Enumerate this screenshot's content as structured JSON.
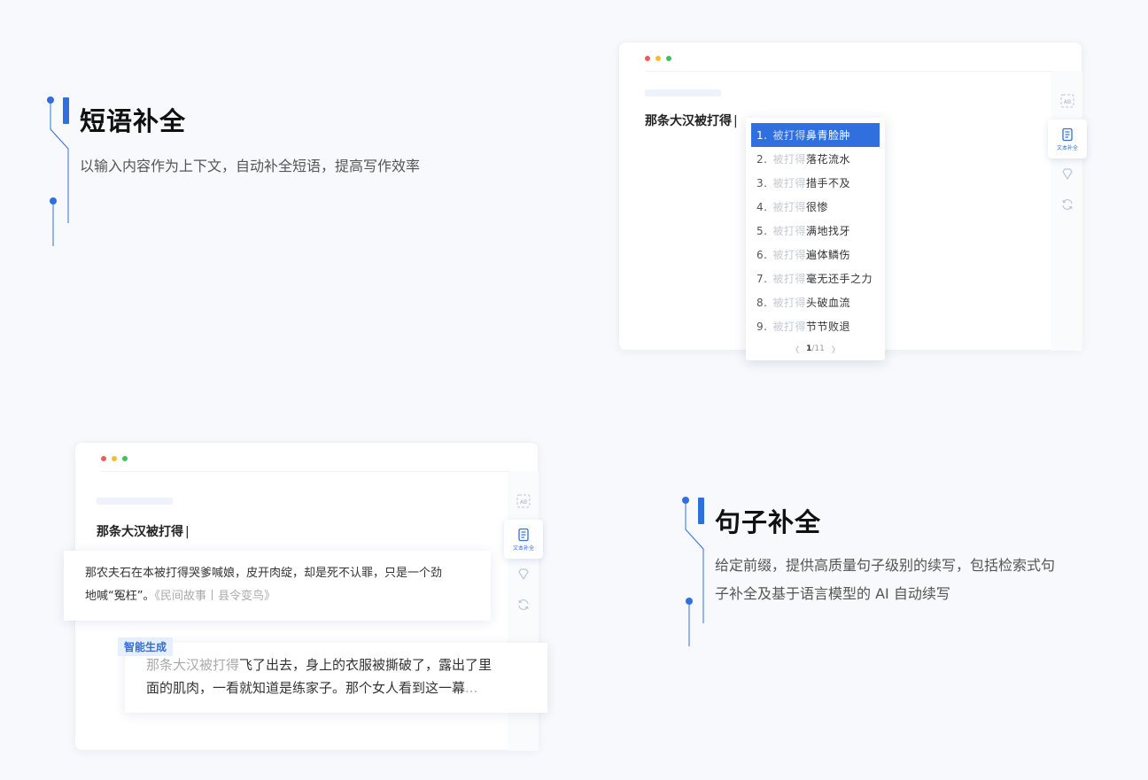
{
  "phrase_feature": {
    "title": "短语补全",
    "description": "以输入内容作为上下文，自动补全短语，提高写作效率"
  },
  "sentence_feature": {
    "title": "句子补全",
    "description_line1": "给定前缀，提供高质量句子级别的续写，包括检索式句",
    "description_line2": "子补全及基于语言模型的 AI 自动续写"
  },
  "window_top": {
    "prompt": "那条大汉被打得",
    "caret": "|",
    "rail_active_label": "文本补全",
    "suggestions": [
      {
        "num": "1.",
        "prefix": "被打得",
        "completion": "鼻青脸肿",
        "selected": true
      },
      {
        "num": "2.",
        "prefix": "被打得",
        "completion": "落花流水",
        "selected": false
      },
      {
        "num": "3.",
        "prefix": "被打得",
        "completion": "措手不及",
        "selected": false
      },
      {
        "num": "4.",
        "prefix": "被打得",
        "completion": "很惨",
        "selected": false
      },
      {
        "num": "5.",
        "prefix": "被打得",
        "completion": "满地找牙",
        "selected": false
      },
      {
        "num": "6.",
        "prefix": "被打得",
        "completion": "遍体鳞伤",
        "selected": false
      },
      {
        "num": "7.",
        "prefix": "被打得",
        "completion": "毫无还手之力",
        "selected": false
      },
      {
        "num": "8.",
        "prefix": "被打得",
        "completion": "头破血流",
        "selected": false
      },
      {
        "num": "9.",
        "prefix": "被打得",
        "completion": "节节败退",
        "selected": false
      }
    ],
    "pager": {
      "prev": "〈",
      "current": "1",
      "sep": "/",
      "total": "11",
      "next": "〉"
    }
  },
  "window_bottom": {
    "prompt": "那条大汉被打得",
    "caret": "|",
    "rail_active_label": "文本补全",
    "retrieval_line1": "那农夫石在本被打得哭爹喊娘，皮开肉绽，却是死不认罪，只是一个劲",
    "retrieval_line2_main": "地喊“冤枉”。",
    "retrieval_line2_source": "《民间故事丨县令变鸟》",
    "ai_tag": "智能生成",
    "ai_prefix": "那条大汉被打得",
    "ai_line1_rest": "飞了出去，身上的衣服被撕破了，露出了里",
    "ai_line2_main": "面的肌肉，一看就知道是练家子。那个女人看到这一幕",
    "ai_line2_ellipsis": "..."
  },
  "colors": {
    "accent": "#2f6fde",
    "dot_red": "#f25b5b",
    "dot_yellow": "#f5bd2f",
    "dot_green": "#3cc45a"
  }
}
